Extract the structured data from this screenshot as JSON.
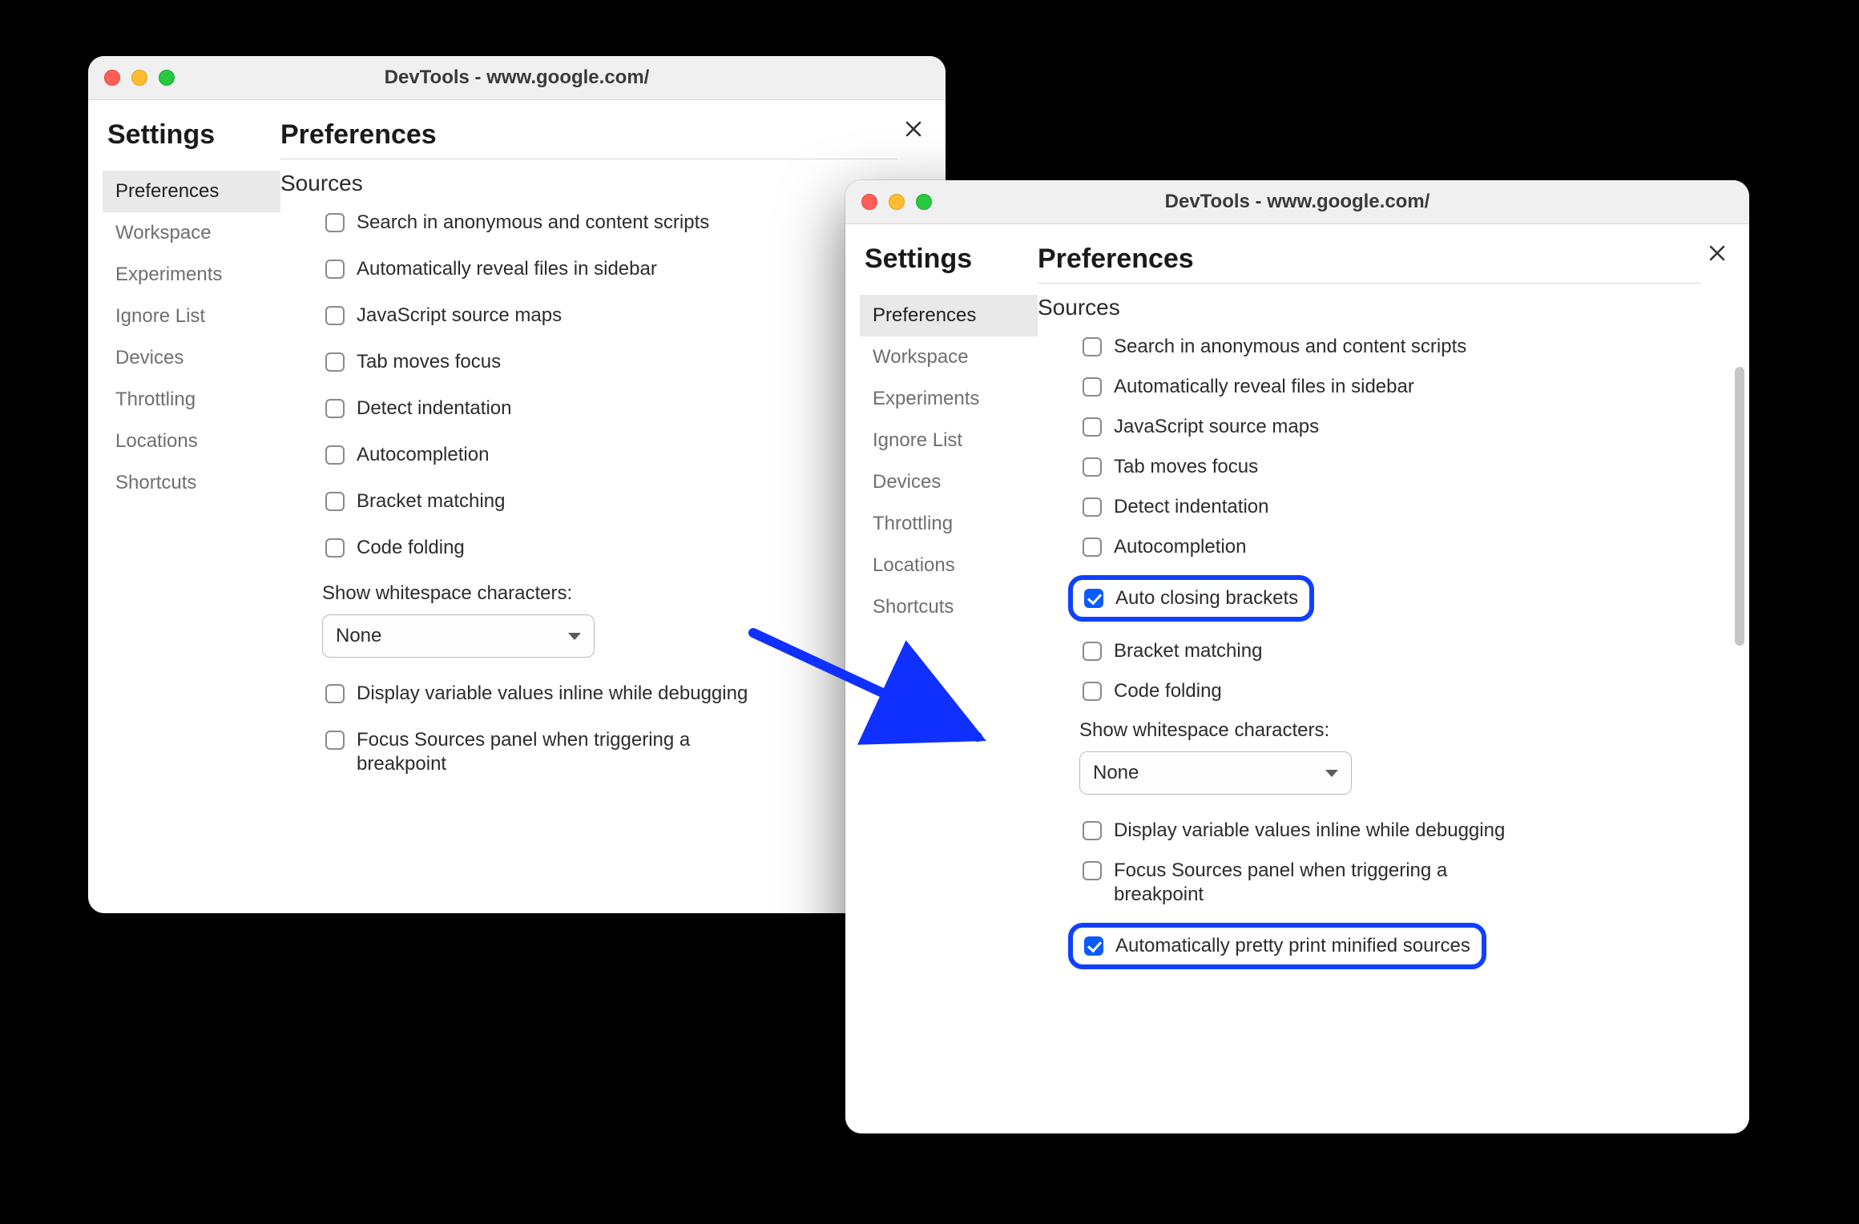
{
  "colors": {
    "highlight": "#1040ff",
    "checkbox_checked": "#0a5bff"
  },
  "window_a": {
    "title": "DevTools - www.google.com/",
    "settings_title": "Settings",
    "prefs_title": "Preferences",
    "close_icon": "close-icon",
    "sidebar": {
      "items": [
        {
          "label": "Preferences",
          "active": true
        },
        {
          "label": "Workspace",
          "active": false
        },
        {
          "label": "Experiments",
          "active": false
        },
        {
          "label": "Ignore List",
          "active": false
        },
        {
          "label": "Devices",
          "active": false
        },
        {
          "label": "Throttling",
          "active": false
        },
        {
          "label": "Locations",
          "active": false
        },
        {
          "label": "Shortcuts",
          "active": false
        }
      ]
    },
    "section_title": "Sources",
    "options": [
      {
        "label": "Search in anonymous and content scripts",
        "checked": false
      },
      {
        "label": "Automatically reveal files in sidebar",
        "checked": false
      },
      {
        "label": "JavaScript source maps",
        "checked": false
      },
      {
        "label": "Tab moves focus",
        "checked": false
      },
      {
        "label": "Detect indentation",
        "checked": false
      },
      {
        "label": "Autocompletion",
        "checked": false
      },
      {
        "label": "Bracket matching",
        "checked": false
      },
      {
        "label": "Code folding",
        "checked": false
      }
    ],
    "whitespace_label": "Show whitespace characters:",
    "whitespace_value": "None",
    "extra_options": [
      {
        "label": "Display variable values inline while debugging",
        "checked": false
      },
      {
        "label": "Focus Sources panel when triggering a breakpoint",
        "checked": false
      }
    ]
  },
  "window_b": {
    "title": "DevTools - www.google.com/",
    "settings_title": "Settings",
    "prefs_title": "Preferences",
    "close_icon": "close-icon",
    "sidebar": {
      "items": [
        {
          "label": "Preferences",
          "active": true
        },
        {
          "label": "Workspace",
          "active": false
        },
        {
          "label": "Experiments",
          "active": false
        },
        {
          "label": "Ignore List",
          "active": false
        },
        {
          "label": "Devices",
          "active": false
        },
        {
          "label": "Throttling",
          "active": false
        },
        {
          "label": "Locations",
          "active": false
        },
        {
          "label": "Shortcuts",
          "active": false
        }
      ]
    },
    "section_title": "Sources",
    "options_top": [
      {
        "label": "Search in anonymous and content scripts",
        "checked": false
      },
      {
        "label": "Automatically reveal files in sidebar",
        "checked": false
      },
      {
        "label": "JavaScript source maps",
        "checked": false
      },
      {
        "label": "Tab moves focus",
        "checked": false
      },
      {
        "label": "Detect indentation",
        "checked": false
      },
      {
        "label": "Autocompletion",
        "checked": false
      }
    ],
    "highlight1": {
      "label": "Auto closing brackets",
      "checked": true
    },
    "options_mid": [
      {
        "label": "Bracket matching",
        "checked": false
      },
      {
        "label": "Code folding",
        "checked": false
      }
    ],
    "whitespace_label": "Show whitespace characters:",
    "whitespace_value": "None",
    "extra_options": [
      {
        "label": "Display variable values inline while debugging",
        "checked": false
      },
      {
        "label": "Focus Sources panel when triggering a breakpoint",
        "checked": false
      }
    ],
    "highlight2": {
      "label": "Automatically pretty print minified sources",
      "checked": true
    }
  }
}
